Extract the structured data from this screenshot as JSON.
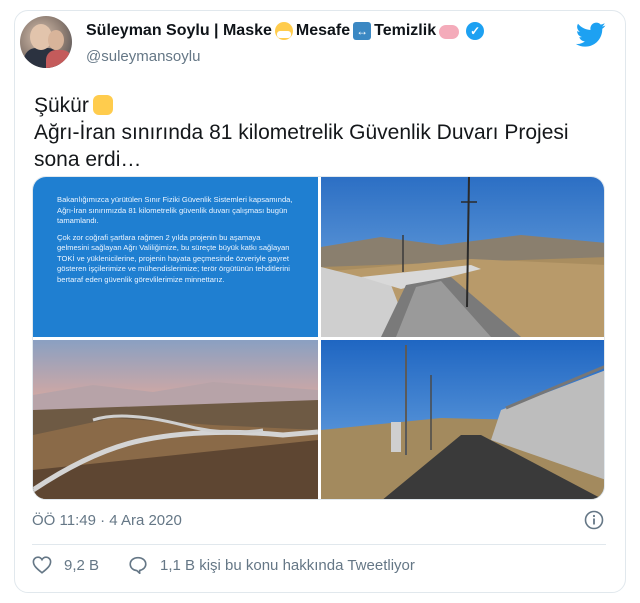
{
  "user": {
    "name_part1": "Süleyman Soylu | Maske",
    "name_part2": "Mesafe",
    "name_part3": "Temizlik",
    "handle": "@suleymansoylu"
  },
  "tweet": {
    "line1": "Şükür",
    "line2": "Ağrı-İran sınırında 81 kilometrelik Güvenlik Duvarı Projesi",
    "line3": "sona erdi…"
  },
  "media": {
    "info_paragraph1": "Bakanlığımızca yürütülen Sınır Fiziki Güvenlik Sistemleri kapsamında, Ağrı-İran sınırımızda 81 kilometrelik güvenlik duvarı çalışması bugün tamamlandı.",
    "info_paragraph2": "Çok zor coğrafi şartlara rağmen 2 yılda projenin bu aşamaya gelmesini sağlayan Ağrı Valiliğimize, bu süreçte büyük katkı sağlayan TOKİ ve yüklenicilerine, projenin hayata geçmesinde özveriyle gayret gösteren işçilerimize ve mühendislerimize; terör örgütünün tehditlerini bertaraf eden güvenlik görevlilerimize minnettarız."
  },
  "meta": {
    "timestamp": "ÖÖ 11:49 · 4 Ara 2020",
    "likes": "9,2 B",
    "talking": "1,1 B kişi bu konu hakkında Tweetliyor"
  },
  "colors": {
    "twitter_blue": "#1da1f2",
    "info_panel_blue": "#1f7fd1",
    "secondary_text": "#657786"
  },
  "icons": [
    "mask-emoji",
    "left-right-arrow-emoji",
    "soap-emoji",
    "verified-icon",
    "twitter-bird-icon",
    "folded-hands-emoji",
    "info-icon",
    "heart-icon",
    "speech-bubble-icon"
  ]
}
